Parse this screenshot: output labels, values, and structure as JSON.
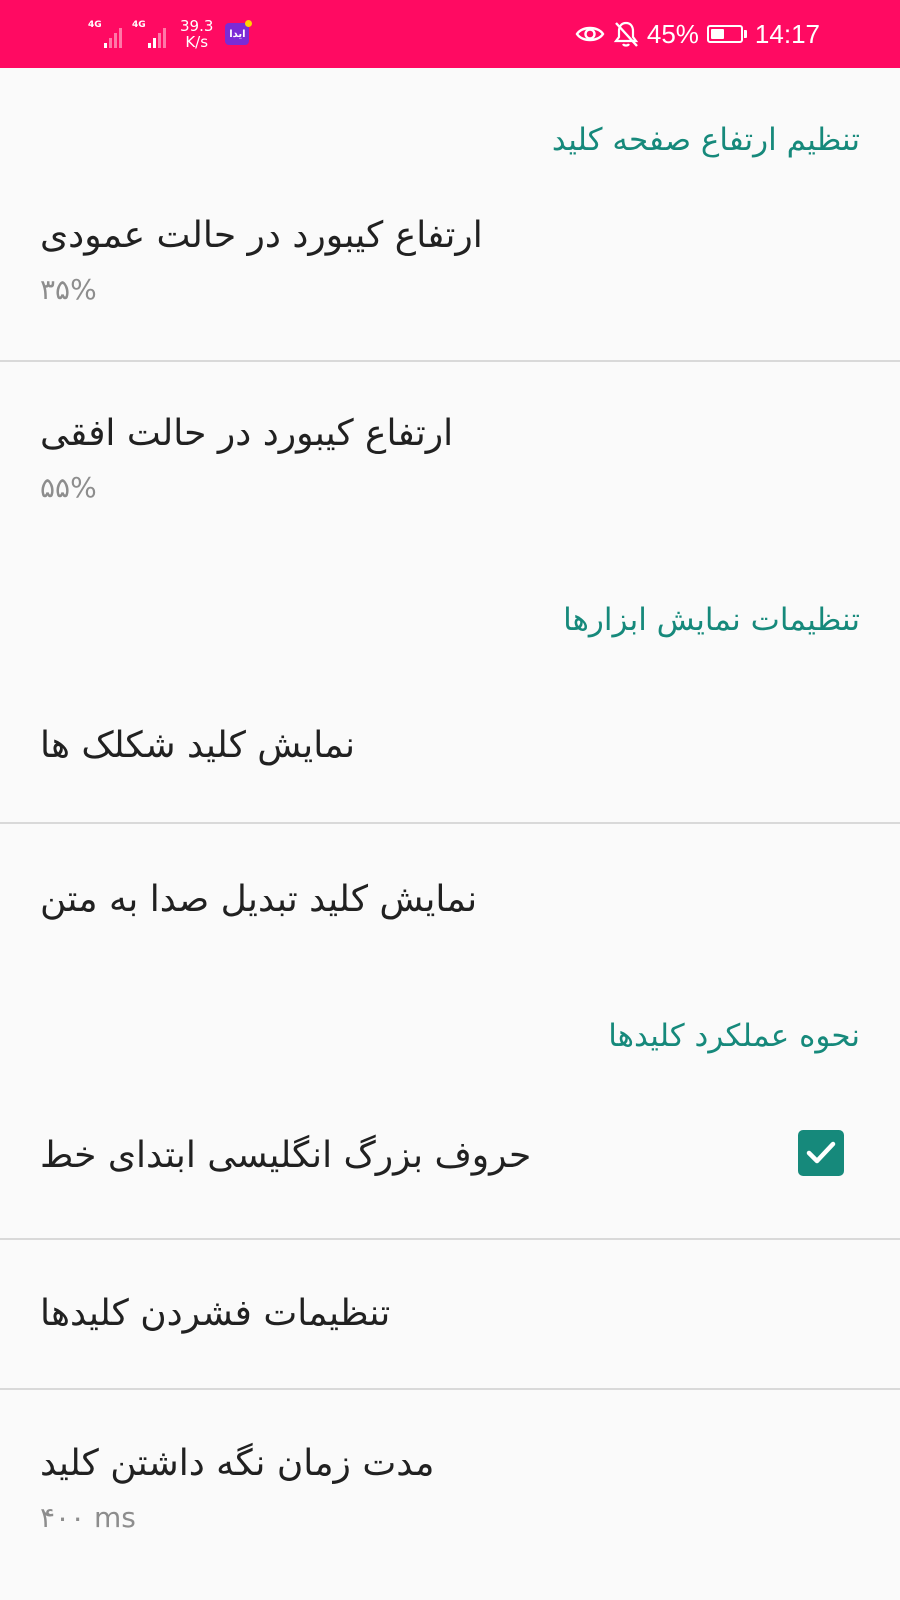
{
  "status_bar": {
    "sim1_label": "4G",
    "sim2_label": "4G",
    "speed_value": "39.3",
    "speed_unit": "K/s",
    "app_notif_label": "ایدا",
    "battery_percent_text": "45%",
    "battery_level": 0.45,
    "time": "14:17",
    "icons": [
      "eye-icon",
      "bell-off-icon",
      "battery-icon"
    ]
  },
  "sections": {
    "height": {
      "header": "تنظیم ارتفاع صفحه کلید",
      "portrait_title": "ارتفاع کیبورد در حالت عمودی",
      "portrait_summary": "۳۵%",
      "landscape_title": "ارتفاع کیبورد در حالت افقی",
      "landscape_summary": "۵۵%"
    },
    "tools": {
      "header": "تنظیمات نمایش ابزارها",
      "emoji_key_title": "نمایش کلید شکلک ها",
      "voice_key_title": "نمایش کلید تبدیل صدا به متن"
    },
    "behavior": {
      "header": "نحوه عملکرد کلیدها",
      "auto_caps_title": "حروف بزرگ انگلیسی ابتدای خط",
      "auto_caps_checked": true,
      "press_settings_title": "تنظیمات فشردن کلیدها",
      "long_press_title": "مدت زمان نگه داشتن کلید",
      "long_press_summary": "۴۰۰ ms"
    }
  },
  "colors": {
    "status_bar": "#ff0a62",
    "accent": "#16897b",
    "background": "#fafafa"
  }
}
